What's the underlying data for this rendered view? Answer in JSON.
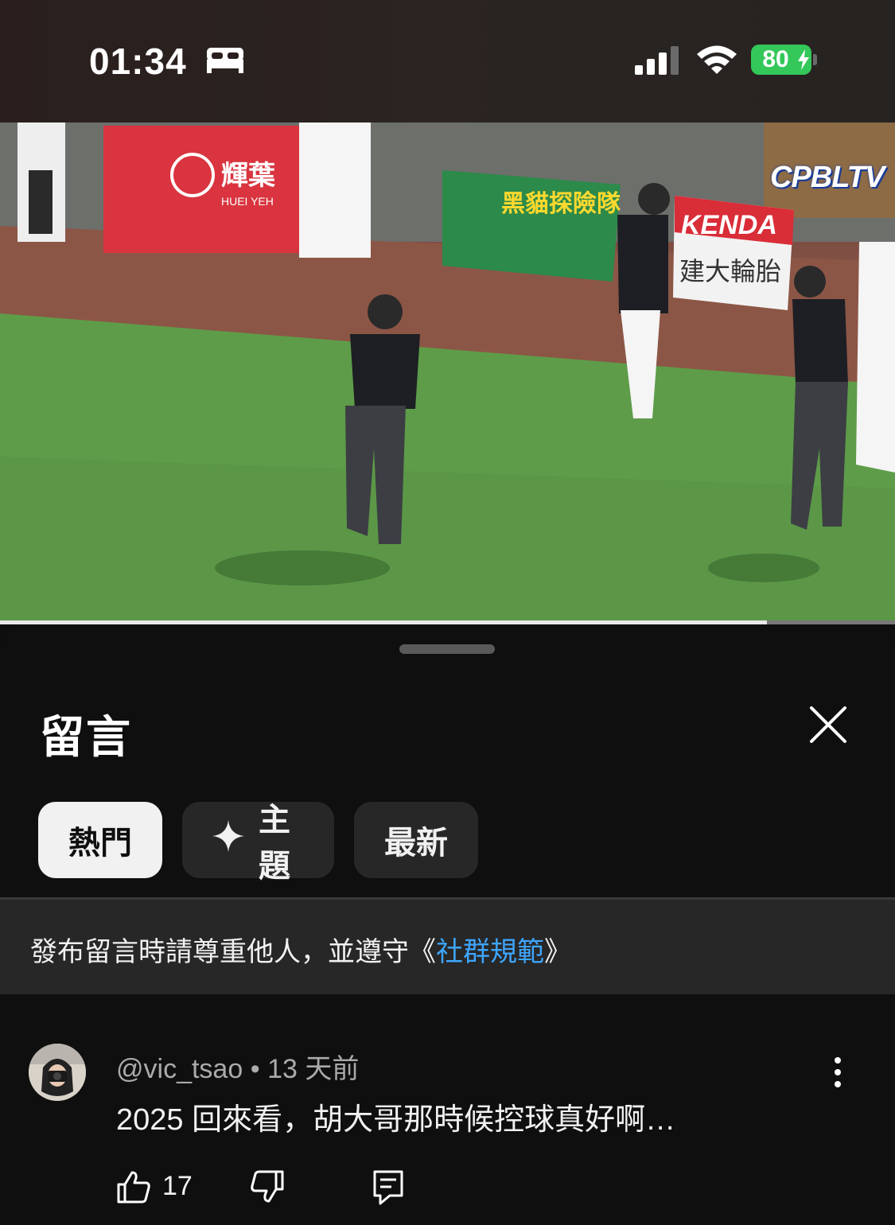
{
  "status_bar": {
    "time": "01:34",
    "battery": "80",
    "icons": [
      "bed-icon",
      "signal-icon",
      "wifi-icon",
      "battery-icon",
      "bolt-icon"
    ]
  },
  "video": {
    "watermark": "CPBLTV",
    "sign_brand_1": "輝葉",
    "sign_brand_1_en": "HUEI YEH",
    "sign_brand_2": "黑貓探險隊",
    "sign_brand_3": "KENDA",
    "sign_brand_3_sub": "建大輪胎",
    "progress": 0.857
  },
  "comments_sheet": {
    "title": "留言",
    "close_icon": "close-icon",
    "chips": [
      {
        "label": "熱門",
        "active": true
      },
      {
        "label": "主題",
        "icon": "sparkle-icon",
        "active": false
      },
      {
        "label": "最新",
        "active": false
      }
    ],
    "notice": {
      "text": "發布留言時請尊重他人，並遵守《",
      "link": "社群規範",
      "suffix": "》"
    },
    "comments": [
      {
        "author": "@vic_tsao",
        "separator": "•",
        "time": "13 天前",
        "text": "2025 回來看，胡大哥那時候控球真好啊…",
        "likes": "17"
      }
    ]
  },
  "colors": {
    "background": "#0f0f0f",
    "chip": "#272727",
    "chip_active": "#f1f1f1",
    "link": "#3ea6ff",
    "battery": "#34c759"
  }
}
